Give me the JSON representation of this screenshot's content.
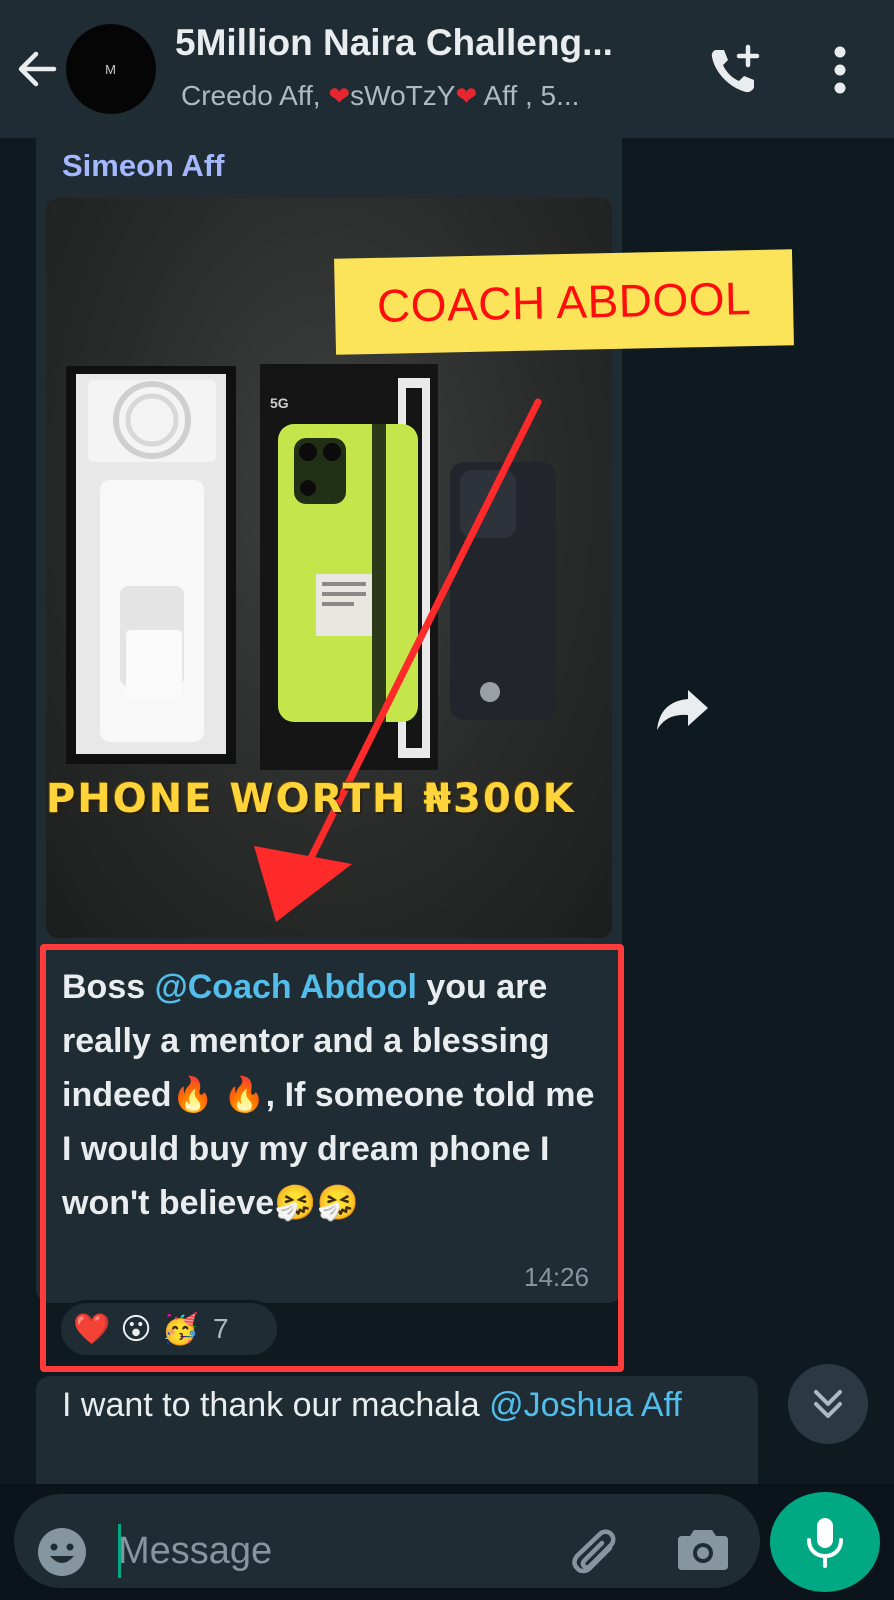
{
  "header": {
    "avatar_text": "M",
    "title": "5Million Naira Challeng...",
    "subtitle_parts": [
      "Creedo Aff, ",
      "sWoTzY",
      " Aff , 5..."
    ]
  },
  "message1": {
    "sender": "Simeon Aff",
    "text_prefix": "Boss ",
    "mention": "@Coach Abdool",
    "text_body": " you are really a mentor and a blessing indeed🔥 🔥, If someone told me I would buy my dream phone I won't believe🤧🤧",
    "time": "14:26",
    "reactions": [
      "❤️",
      "😮",
      "🥳"
    ],
    "reaction_count": "7"
  },
  "message2": {
    "text": "I want to thank our machala ",
    "mention": "@Joshua Aff"
  },
  "overlays": {
    "banner": "COACH ABDOOL",
    "caption": "PHONE WORTH ₦300K"
  },
  "input": {
    "placeholder": "Message"
  },
  "icons": {
    "back": "arrow-left-icon",
    "call": "add-call-icon",
    "menu": "more-vertical-icon",
    "forward": "forward-icon",
    "scroll": "double-chevron-down-icon",
    "emoji": "emoji-icon",
    "attach": "paperclip-icon",
    "camera": "camera-icon",
    "mic": "microphone-icon"
  },
  "colors": {
    "header_bg": "#1f2c33",
    "chat_bg": "#0e1a20",
    "accent": "#00a884",
    "mention": "#53bdeb",
    "highlight_box": "#ff3b3b",
    "banner_bg": "#fbe35a",
    "banner_text": "#ff0d0d",
    "caption": "#ffd43b"
  }
}
